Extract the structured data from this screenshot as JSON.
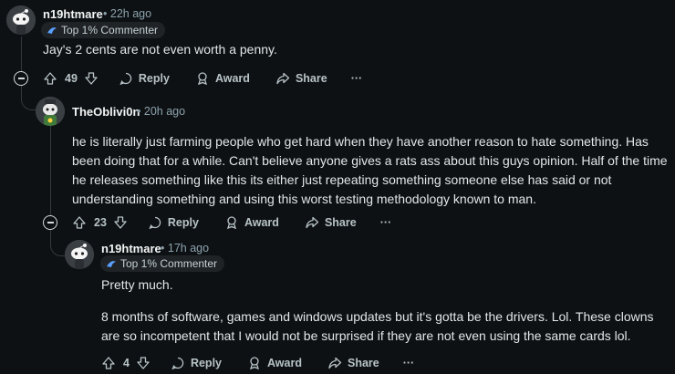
{
  "comments": [
    {
      "author": "n19htmare",
      "time": "22h ago",
      "flair": "Top 1% Commenter",
      "body": [
        "Jay's 2 cents are not even worth a penny."
      ],
      "votes": "49",
      "reply_label": "Reply",
      "award_label": "Award",
      "share_label": "Share",
      "more_label": "···"
    },
    {
      "author": "TheOblivi0n",
      "time": "20h ago",
      "body": [
        "he is literally just farming people who get hard when they have another reason to hate something. Has",
        "been doing that for a while. Can't believe anyone gives a rats ass about this guys opinion. Half of the time",
        "he releases something like this its either just repeating something someone else has said or not",
        "understanding something and using this worst testing methodology known to man."
      ],
      "votes": "23",
      "reply_label": "Reply",
      "award_label": "Award",
      "share_label": "Share",
      "more_label": "···"
    },
    {
      "author": "n19htmare",
      "time": "17h ago",
      "flair": "Top 1% Commenter",
      "body": [
        "Pretty much.",
        "8 months of software, games and windows updates but it's gotta be the drivers. Lol. These clowns",
        "are so incompetent that I would not be surprised if they are not even using the same cards lol."
      ],
      "votes": "4",
      "reply_label": "Reply",
      "award_label": "Award",
      "share_label": "Share",
      "more_label": "···"
    }
  ],
  "meta_separator": "•"
}
